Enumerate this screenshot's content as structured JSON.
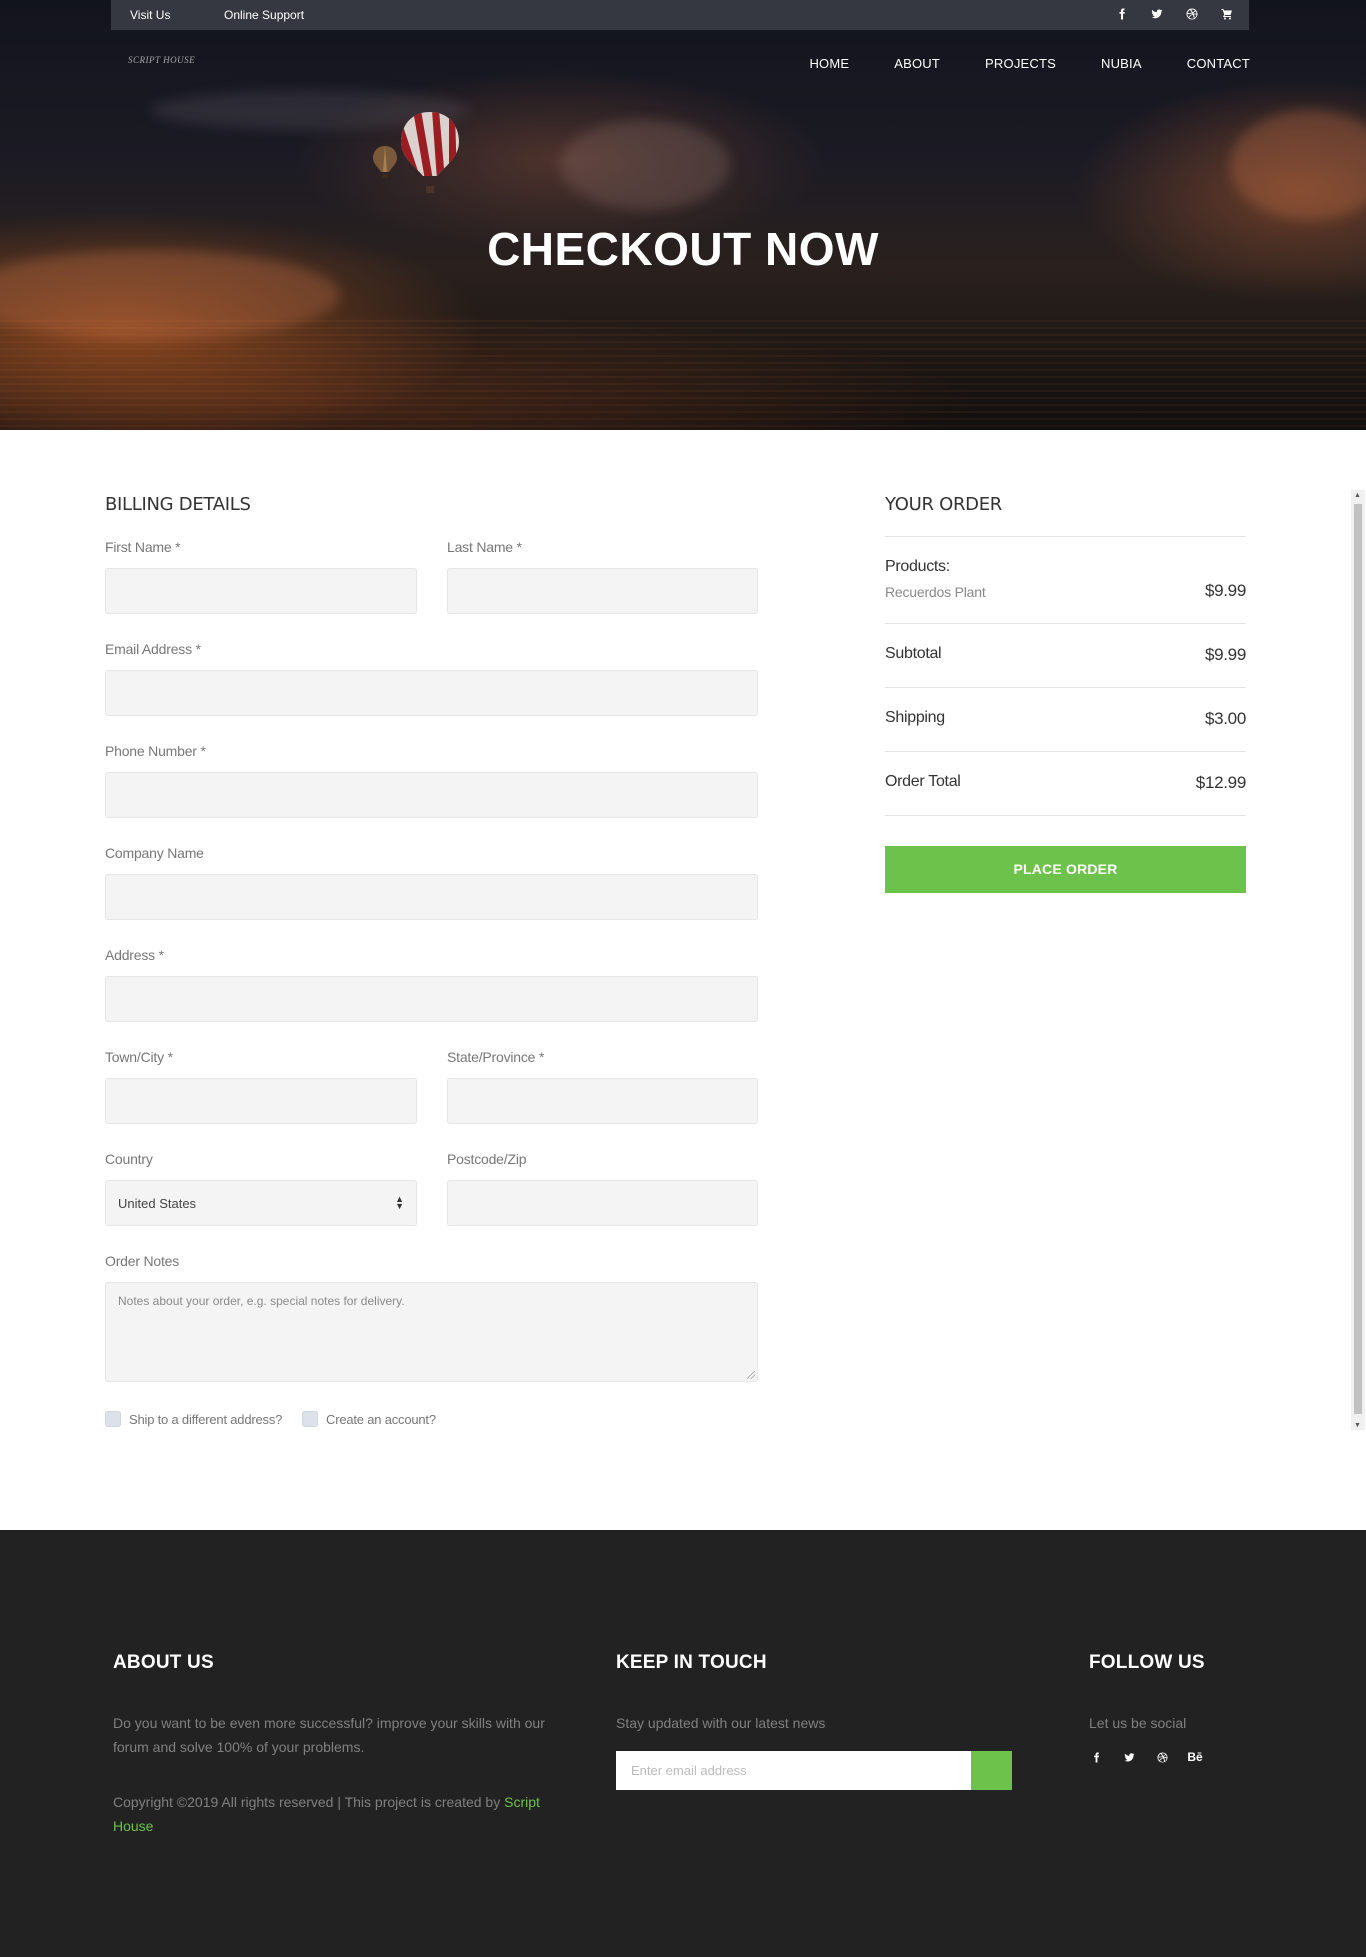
{
  "topbar": {
    "visit_us": "Visit Us",
    "online_support": "Online Support",
    "icons": [
      "facebook-icon",
      "twitter-icon",
      "dribbble-icon",
      "cart-icon"
    ]
  },
  "brand": {
    "logo_text": "SCRIPT HOUSE"
  },
  "nav": {
    "items": [
      "HOME",
      "ABOUT",
      "PROJECTS",
      "NUBIA",
      "CONTACT"
    ]
  },
  "hero": {
    "title": "CHECKOUT NOW"
  },
  "billing": {
    "heading": "BILLING DETAILS",
    "first_name_label": "First Name *",
    "last_name_label": "Last Name *",
    "email_label": "Email Address *",
    "phone_label": "Phone Number *",
    "company_label": "Company Name",
    "address_label": "Address *",
    "town_label": "Town/City *",
    "state_label": "State/Province *",
    "country_label": "Country",
    "country_value": "United States",
    "postcode_label": "Postcode/Zip",
    "notes_label": "Order Notes",
    "notes_placeholder": "Notes about your order, e.g. special notes for delivery.",
    "ship_different_label": "Ship to a different address?",
    "create_account_label": "Create an account?"
  },
  "order": {
    "heading": "YOUR ORDER",
    "products_label": "Products:",
    "product_name": "Recuerdos Plant",
    "product_price": "$9.99",
    "subtotal_label": "Subtotal",
    "subtotal_value": "$9.99",
    "shipping_label": "Shipping",
    "shipping_value": "$3.00",
    "total_label": "Order Total",
    "total_value": "$12.99",
    "place_order_label": "PLACE ORDER"
  },
  "footer": {
    "about_heading": "ABOUT US",
    "about_text": "Do you want to be even more successful? improve your skills with our forum and solve 100% of your problems.",
    "copyright_prefix": "Copyright ©2019 All rights reserved | This project is created by ",
    "copyright_link": "Script House",
    "keep_heading": "KEEP IN TOUCH",
    "keep_text": "Stay updated with our latest news",
    "email_placeholder": "Enter email address",
    "follow_heading": "FOLLOW US",
    "follow_text": "Let us be social",
    "social_behance": "Bē"
  },
  "colors": {
    "accent": "#6cc24a",
    "footer_bg": "#222222",
    "field_bg": "#f4f4f4"
  }
}
